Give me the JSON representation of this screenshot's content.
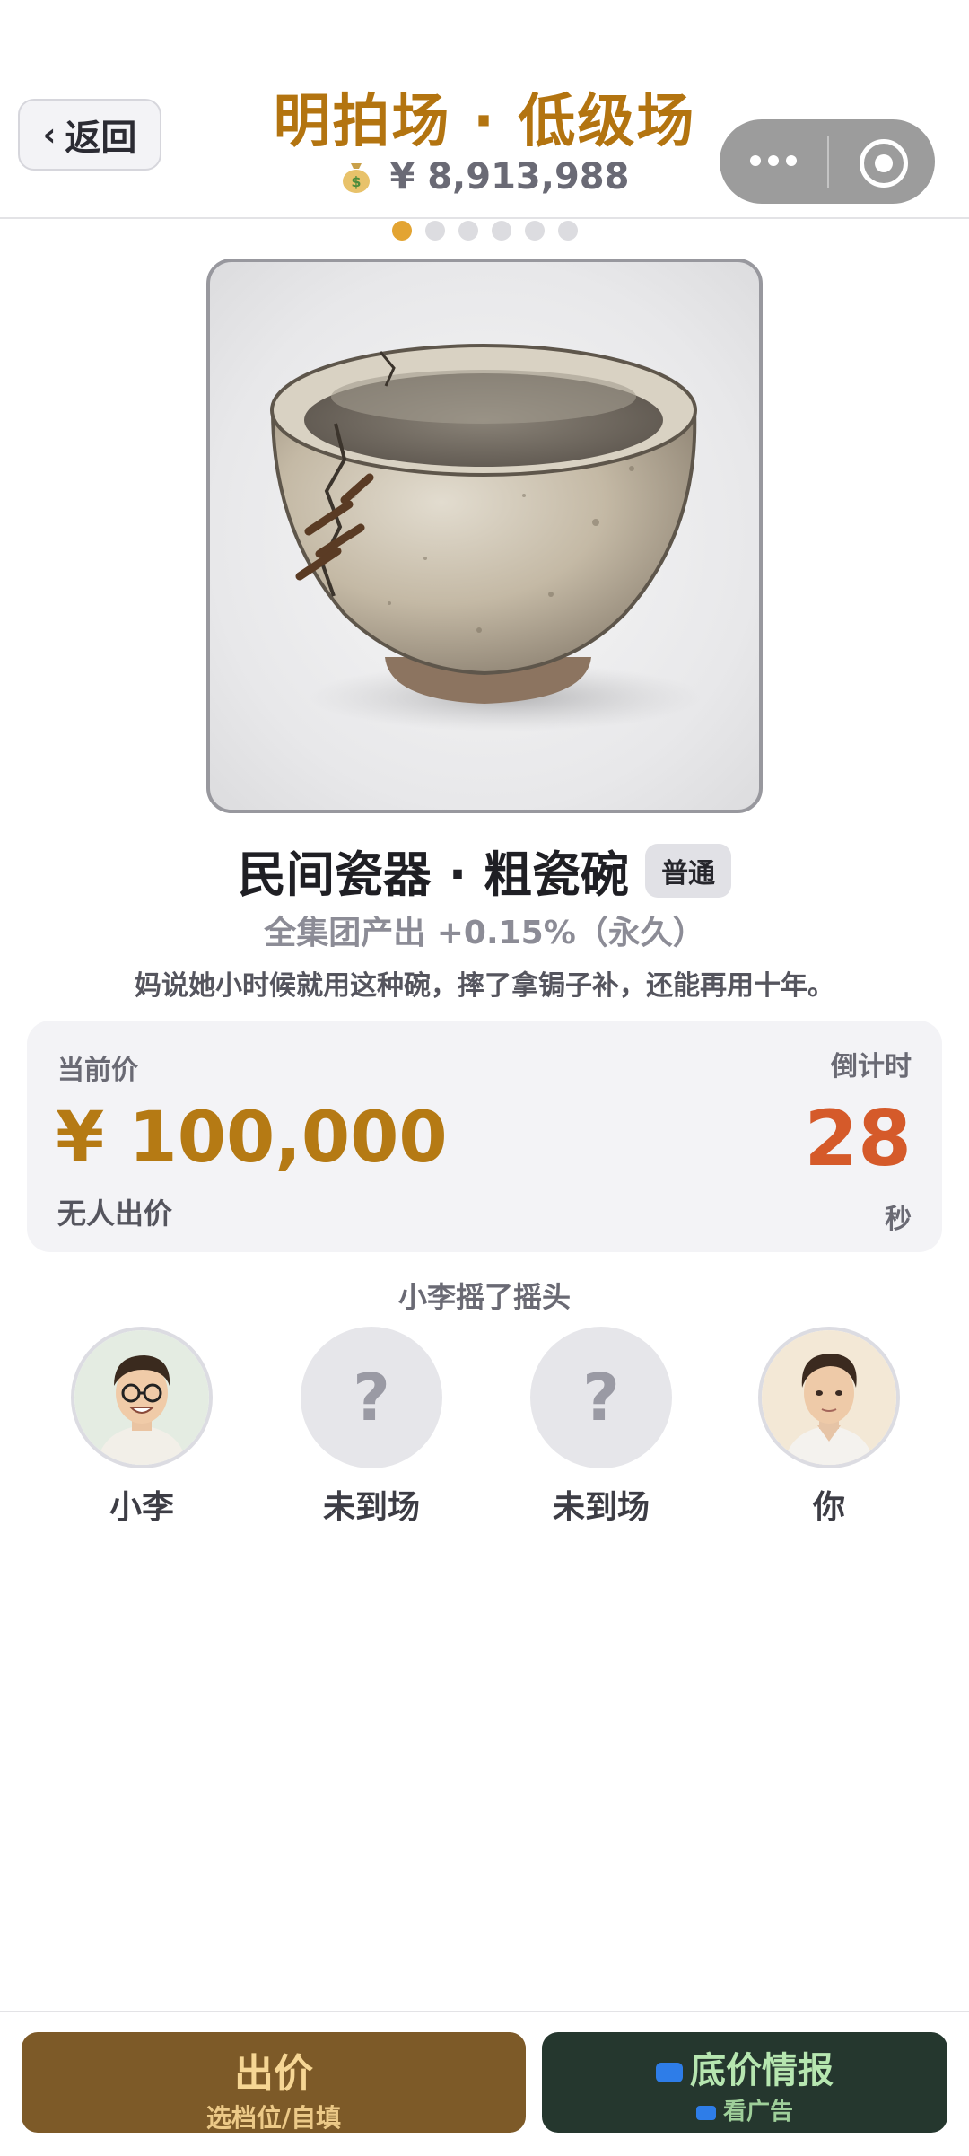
{
  "header": {
    "back_label": "返回",
    "title": "明拍场 · 低级场",
    "balance": "¥ 8,913,988",
    "balance_icon": "money-bag-icon"
  },
  "pager": {
    "count": 6,
    "active_index": 0
  },
  "item": {
    "name": "民间瓷器 · 粗瓷碗",
    "rarity": "普通",
    "effect": "全集团产出 +0.15%（永久）",
    "description": "妈说她小时候就用这种碗，摔了拿锔子补，还能再用十年。"
  },
  "price_panel": {
    "current_label": "当前价",
    "current_price": "¥ 100,000",
    "status": "无人出价",
    "countdown_label": "倒计时",
    "countdown_value": "28",
    "countdown_unit": "秒"
  },
  "action_message": "小李摇了摇头",
  "bidders": [
    {
      "name": "小李",
      "avatar": "photo"
    },
    {
      "name": "未到场",
      "avatar": "empty",
      "placeholder": "?"
    },
    {
      "name": "未到场",
      "avatar": "empty",
      "placeholder": "?"
    },
    {
      "name": "你",
      "avatar": "photo"
    }
  ],
  "bottom": {
    "bid_label": "出价",
    "bid_sub": "选档位/自填",
    "intel_label": "底价情报",
    "intel_sub": "看广告"
  },
  "colors": {
    "title": "#b37410",
    "price": "#b57a14",
    "countdown": "#d55a2a",
    "bid_button": "#7d5a28",
    "intel_button": "#25372e"
  }
}
